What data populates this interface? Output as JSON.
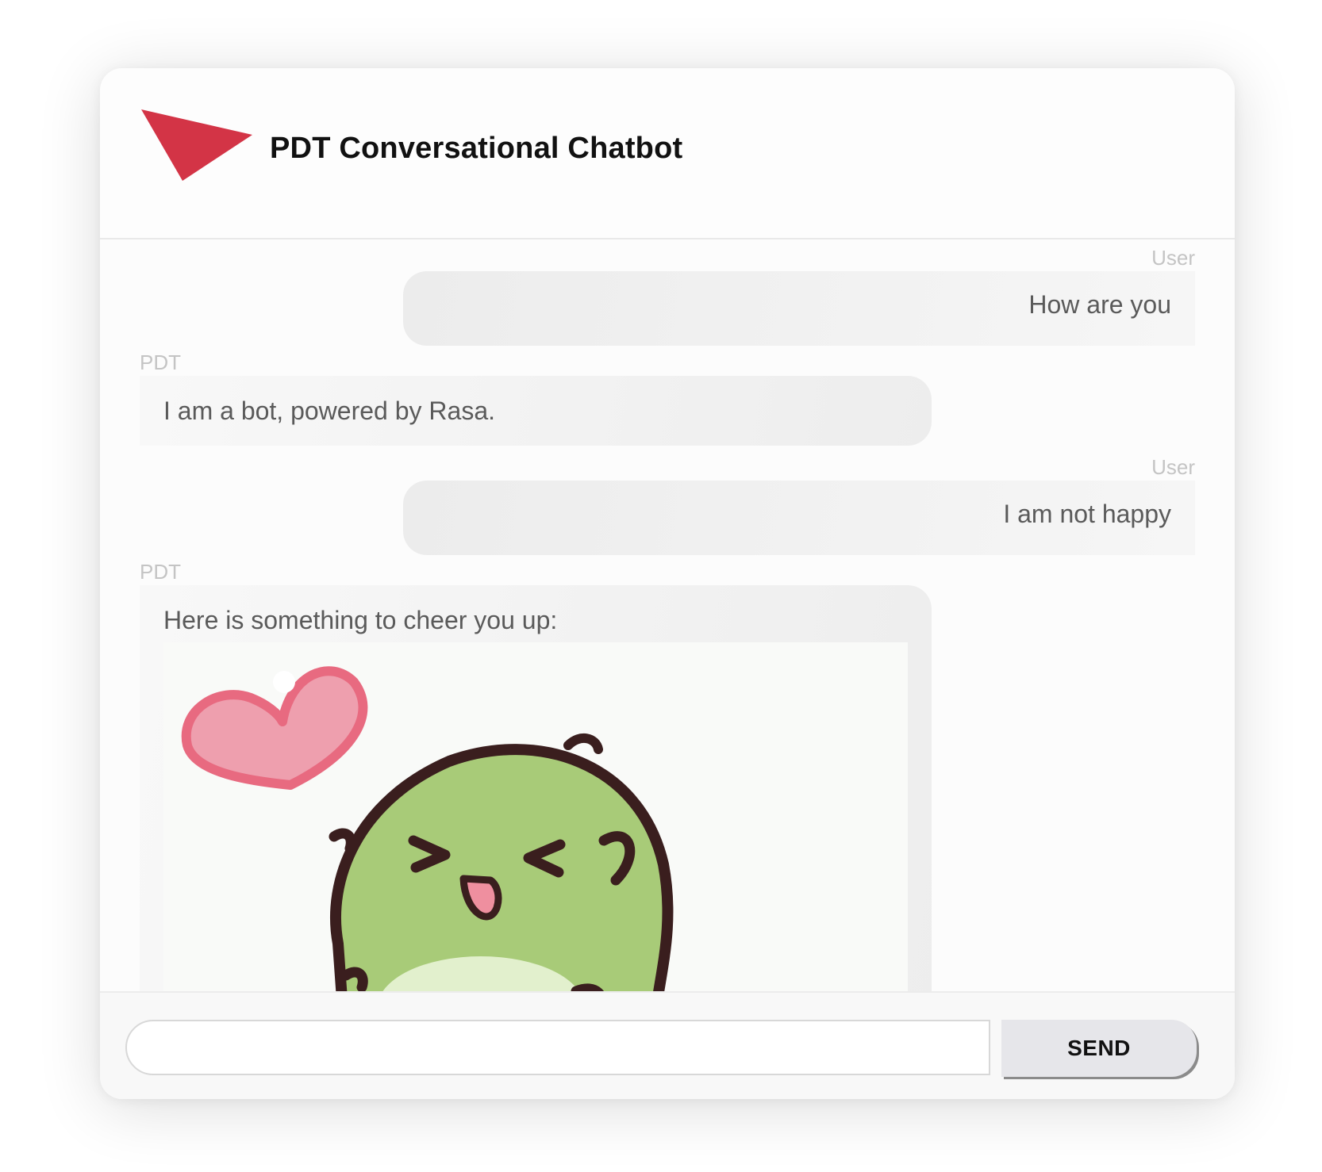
{
  "header": {
    "title": "PDT Conversational Chatbot",
    "logo_icon": "red-paper-plane-triangle",
    "brand_color": "#d33446"
  },
  "messages": [
    {
      "sender": "User",
      "text": "How are you"
    },
    {
      "sender": "PDT",
      "text": "I am a bot, powered by Rasa."
    },
    {
      "sender": "User",
      "text": "I am not happy"
    },
    {
      "sender": "PDT",
      "text": "Here is something to cheer you up:",
      "image": "happy-green-frog-with-heart-gif"
    }
  ],
  "composer": {
    "input_value": "",
    "input_placeholder": "",
    "send_label": "SEND"
  }
}
